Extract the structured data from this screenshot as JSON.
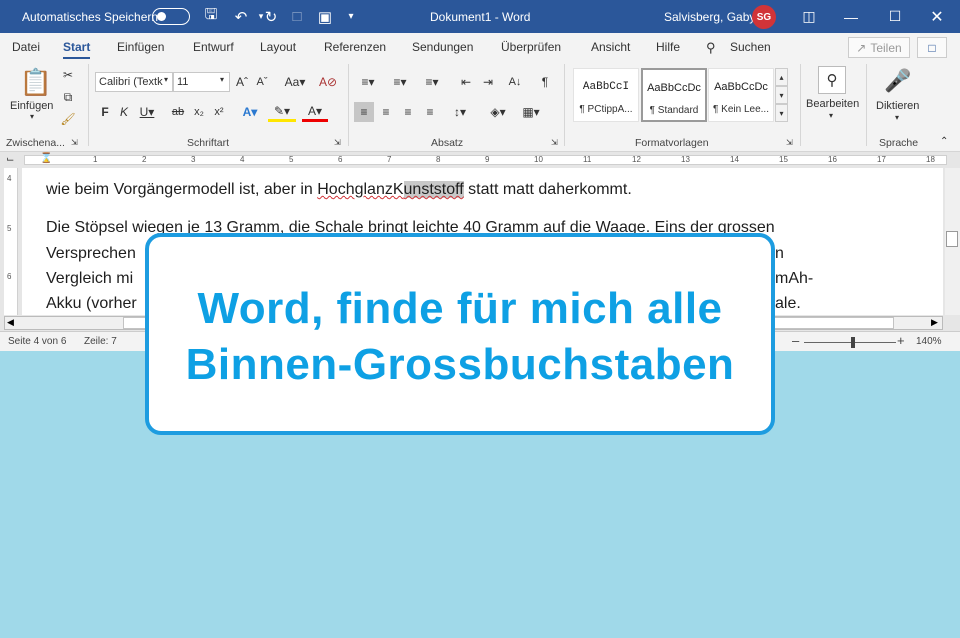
{
  "titlebar": {
    "autosave_label": "Automatisches Speichern",
    "document_title": "Dokument1  -  Word",
    "user_name": "Salvisberg, Gaby",
    "user_initials": "SG"
  },
  "menu": {
    "tabs": [
      "Datei",
      "Start",
      "Einfügen",
      "Entwurf",
      "Layout",
      "Referenzen",
      "Sendungen",
      "Überprüfen",
      "Ansicht",
      "Hilfe"
    ],
    "active_tab": "Start",
    "search_label": "Suchen",
    "share_label": "Teilen"
  },
  "ribbon": {
    "clipboard": {
      "paste_label": "Einfügen",
      "group_label": "Zwischena..."
    },
    "font": {
      "font_name": "Calibri (Textk",
      "font_size": "11",
      "group_label": "Schriftart"
    },
    "paragraph": {
      "group_label": "Absatz"
    },
    "styles": {
      "group_label": "Formatvorlagen",
      "items": [
        {
          "preview": "AaBbCcI",
          "name": "¶ PCtippA..."
        },
        {
          "preview": "AaBbCcDc",
          "name": "¶ Standard"
        },
        {
          "preview": "AaBbCcDc",
          "name": "¶ Kein Lee..."
        }
      ]
    },
    "editing": {
      "label": "Bearbeiten"
    },
    "voice": {
      "label": "Diktieren",
      "group_label": "Sprache"
    }
  },
  "ruler": {
    "numbers": [
      "1",
      "2",
      "3",
      "4",
      "5",
      "6",
      "7",
      "8",
      "9",
      "10",
      "11",
      "12",
      "13",
      "14",
      "15",
      "16",
      "17",
      "18"
    ]
  },
  "document": {
    "line1_a": "wie beim Vorgängermodell ist, aber in ",
    "line1_word_a": "HochglanzK",
    "line1_word_b": "unststoff",
    "line1_b": " statt matt daherkommt.",
    "line2": "Die Stöpsel wiegen je 13 Gramm, die Schale bringt leichte 40 Gramm auf die Waage. Eins der grossen",
    "line3_a": "Versprechen",
    "line3_b": "n",
    "line4_a": "Vergleich mi",
    "line4_b": "mAh-",
    "line5_a": "Akku (vorher",
    "line5_b": "ale."
  },
  "statusbar": {
    "page": "Seite 4 von 6",
    "line": "Zeile: 7",
    "zoom": "140%"
  },
  "overlay": {
    "line1": "Word, finde für mich alle",
    "line2": "Binnen-Grossbuchstaben"
  },
  "colors": {
    "titlebar": "#2b579a",
    "overlay_text": "#0ea0e4",
    "background": "#a0d9e9"
  }
}
